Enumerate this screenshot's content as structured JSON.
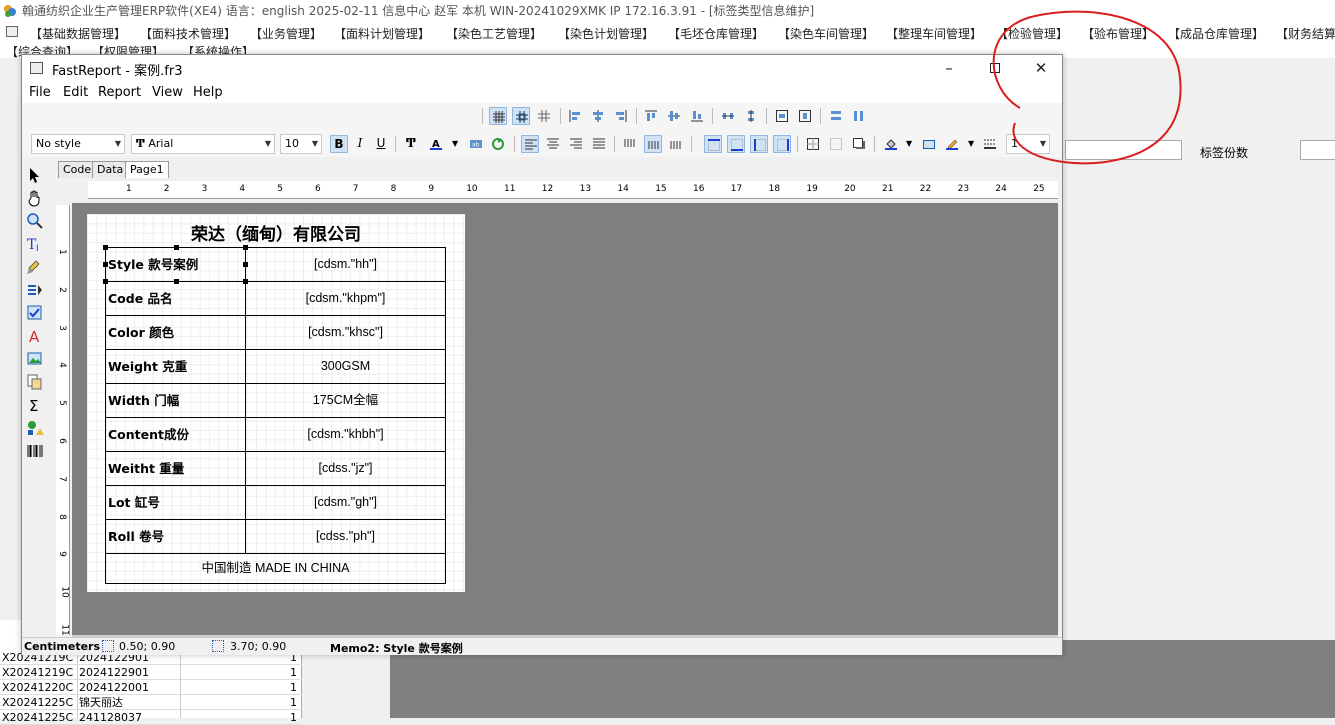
{
  "erp": {
    "title": "翰通纺织企业生产管理ERP软件(XE4)  语言：english  2025-02-11  信息中心 赵军 本机 WIN-20241029XMK IP 172.16.3.91 - [标签类型信息维护]",
    "menu": [
      "【基础数据管理】",
      "【面料技术管理】",
      "【业务管理】",
      "【面料计划管理】",
      "【染色工艺管理】",
      "【染色计划管理】",
      "【毛坯仓库管理】",
      "【染色车间管理】",
      "【整理车间管理】",
      "【检验管理】",
      "【验布管理】",
      "【成品仓库管理】",
      "【财务结算"
    ],
    "menu_row2": [
      "【综合查询】",
      "【权限管理】",
      "【系统操作】"
    ],
    "label_copies": "标签份数",
    "grid_rows": [
      {
        "a": "X20241219C",
        "b": "2024122901",
        "c": "1"
      },
      {
        "a": "X20241219C",
        "b": "2024122901",
        "c": "1"
      },
      {
        "a": "X20241220C",
        "b": "2024122001",
        "c": "1"
      },
      {
        "a": "X20241225C",
        "b": "锦天丽达",
        "c": "1"
      },
      {
        "a": "X20241225C",
        "b": "241128037",
        "c": "1"
      }
    ]
  },
  "fr": {
    "title": "FastReport - 案例.fr3",
    "menus": [
      "File",
      "Edit",
      "Report",
      "View",
      "Help"
    ],
    "style_combo": "No style",
    "font_combo": "Arial",
    "size_combo": "10",
    "line_width": "1",
    "tabs": [
      "Code",
      "Data",
      "Page1"
    ],
    "ruler_h": [
      "1",
      "2",
      "3",
      "4",
      "5",
      "6",
      "7",
      "8",
      "9",
      "10",
      "11",
      "12",
      "13",
      "14",
      "15",
      "16",
      "17",
      "18",
      "19",
      "20",
      "21",
      "22",
      "23",
      "24",
      "25"
    ],
    "ruler_v": [
      "1",
      "2",
      "3",
      "4",
      "5",
      "6",
      "7",
      "8",
      "9",
      "10",
      "11"
    ],
    "page_title": "荣达（缅甸）有限公司",
    "rows": [
      {
        "label": "Style 款号案例",
        "value": "[cdsm.\"hh\"]"
      },
      {
        "label": "Code  品名",
        "value": "[cdsm.\"khpm\"]"
      },
      {
        "label": "Color 颜色",
        "value": "[cdsm.\"khsc\"]"
      },
      {
        "label": "Weight 克重",
        "value": "300GSM"
      },
      {
        "label": "Width 门幅",
        "value": "175CM全幅"
      },
      {
        "label": "Content成份",
        "value": "[cdsm.\"khbh\"]"
      },
      {
        "label": "Weitht 重量",
        "value": "[cdss.\"jz\"]"
      },
      {
        "label": "Lot  缸号",
        "value": "[cdsm.\"gh\"]"
      },
      {
        "label": "Roll  卷号",
        "value": "[cdss.\"ph\"]"
      }
    ],
    "footer": "中国制造 MADE IN CHINA",
    "status": {
      "units": "Centimeters",
      "pos": "0.50; 0.90",
      "size": "3.70; 0.90",
      "selection": "Memo2: Style  款号案例"
    }
  }
}
